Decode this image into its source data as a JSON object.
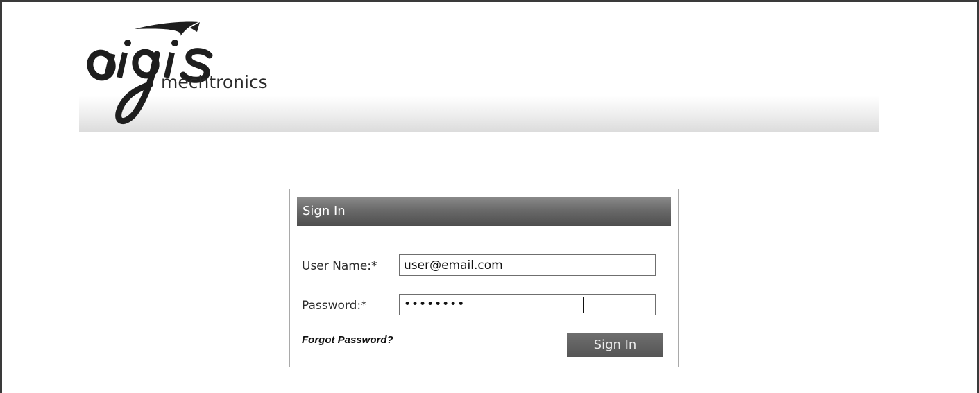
{
  "brand": {
    "logo_mark": "aigis",
    "logo_wordmark": "mechtronics"
  },
  "signin_panel": {
    "title": "Sign In",
    "username_label": "User Name:*",
    "username_value": "user@email.com",
    "password_label": "Password:*",
    "password_value_masked": "••••••••",
    "forgot_password_label": "Forgot Password?",
    "submit_label": "Sign In"
  },
  "colors": {
    "panel_header": "#5e5e5e",
    "button": "#616161",
    "frame": "#3a3a3a"
  }
}
